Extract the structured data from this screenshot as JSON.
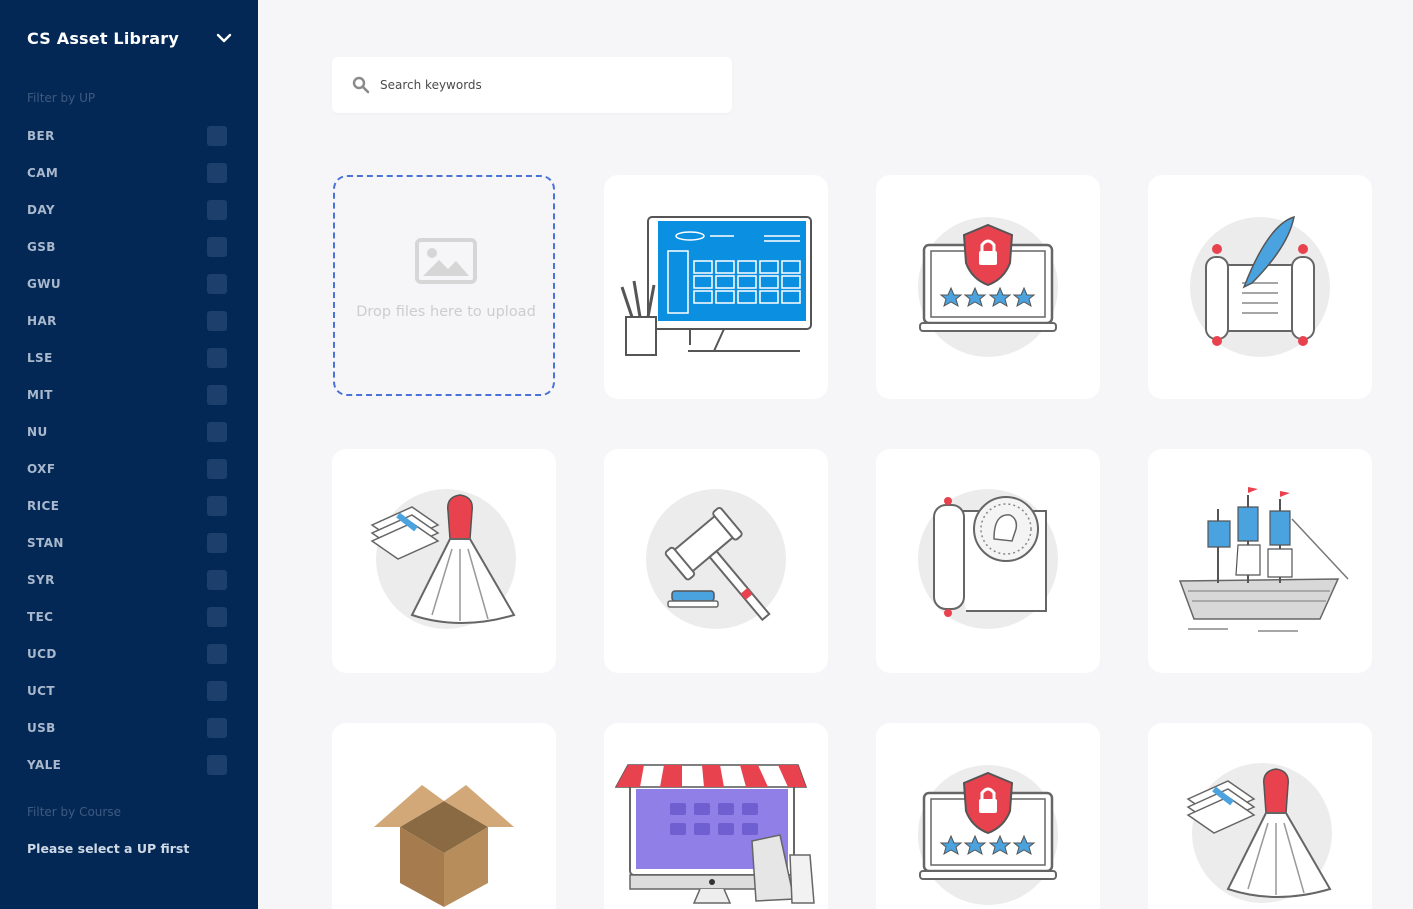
{
  "sidebar": {
    "title": "CS Asset Library",
    "filter_up_label": "Filter by UP",
    "up_items": [
      "BER",
      "CAM",
      "DAY",
      "GSB",
      "GWU",
      "HAR",
      "LSE",
      "MIT",
      "NU",
      "OXF",
      "RICE",
      "STAN",
      "SYR",
      "TEC",
      "UCD",
      "UCT",
      "USB",
      "YALE"
    ],
    "filter_course_label": "Filter by Course",
    "course_hint": "Please select a UP first"
  },
  "search": {
    "placeholder": "Search keywords"
  },
  "upload": {
    "text": "Drop files here to upload"
  },
  "assets": [
    {
      "icon": "computer-spreadsheet-icon"
    },
    {
      "icon": "laptop-security-rating-icon"
    },
    {
      "icon": "scroll-quill-icon"
    },
    {
      "icon": "dress-money-icon"
    },
    {
      "icon": "gavel-icon"
    },
    {
      "icon": "scroll-coin-icon"
    },
    {
      "icon": "sailing-ship-icon"
    },
    {
      "icon": "open-box-icon"
    },
    {
      "icon": "online-store-icon"
    },
    {
      "icon": "laptop-security-rating-icon"
    },
    {
      "icon": "dress-money-icon"
    }
  ],
  "colors": {
    "sidebar_bg": "#032856",
    "page_bg": "#f6f5f7",
    "accent_blue": "#4aa3df",
    "accent_red": "#e8424e",
    "dropzone_border": "#4a73d9"
  }
}
